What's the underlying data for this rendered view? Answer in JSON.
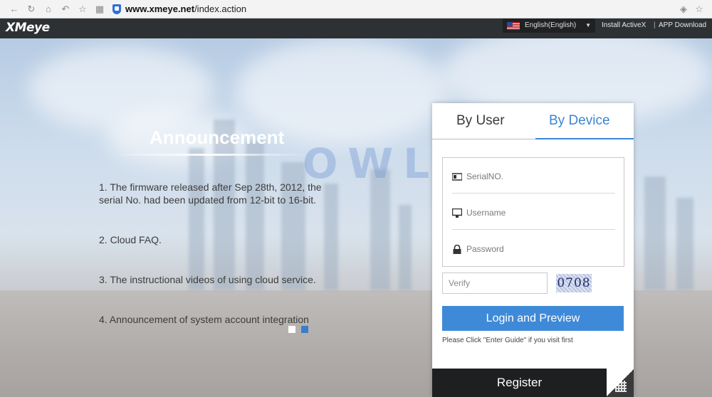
{
  "browser": {
    "url_host": "www.xmeye.net",
    "url_path": "/index.action"
  },
  "header": {
    "logo": "XMeye",
    "language": "English(English)",
    "links": [
      "Install ActiveX",
      "APP Download"
    ],
    "separator": "|"
  },
  "watermark": "OWLCAT",
  "announcement": {
    "title": "Announcement",
    "items": [
      "1. The firmware released after Sep 28th, 2012, the serial No. had been updated from 12-bit to 16-bit.",
      "2. Cloud FAQ.",
      "3. The instructional videos of using cloud service.",
      "4. Announcement of system account integration"
    ]
  },
  "carousel": {
    "active_index": 1,
    "count": 2
  },
  "login": {
    "tabs": [
      "By User",
      "By Device"
    ],
    "active_tab": "By Device",
    "serial_placeholder": "SerialNO.",
    "username_placeholder": "Username",
    "password_placeholder": "Password",
    "verify_placeholder": "Verify",
    "captcha": "0708",
    "login_button": "Login and Preview",
    "hint": "Please Click \"Enter Guide\" if you visit first",
    "register_button": "Register"
  },
  "colors": {
    "accent": "#3f8ad8",
    "header_bg": "#2e3134",
    "register_bg": "#1e1f21"
  }
}
